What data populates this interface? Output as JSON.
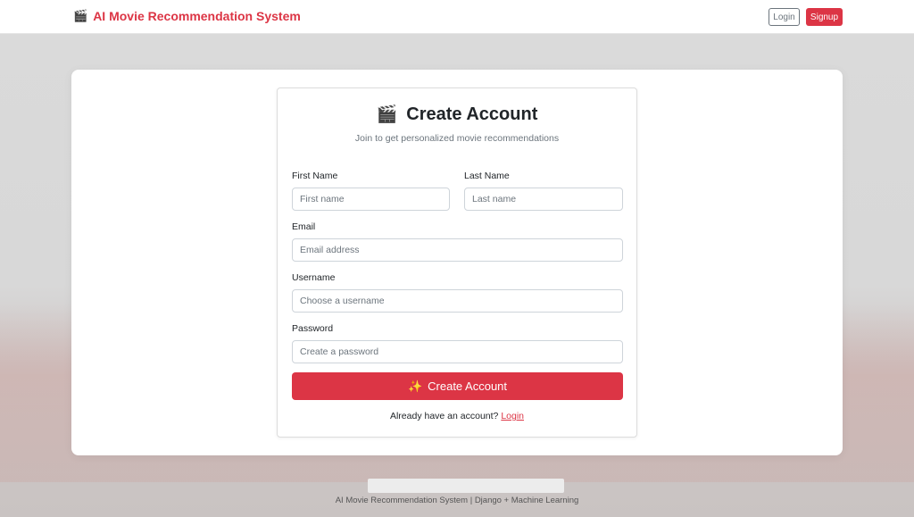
{
  "navbar": {
    "brand_icon": "clapper-board-icon",
    "brand_text": "AI Movie Recommendation System",
    "login_label": "Login",
    "signup_label": "Signup"
  },
  "form": {
    "title_icon": "clapper-board-icon",
    "title": "Create Account",
    "subtitle": "Join to get personalized movie recommendations",
    "first_name": {
      "label": "First Name",
      "placeholder": "First name"
    },
    "last_name": {
      "label": "Last Name",
      "placeholder": "Last name"
    },
    "email": {
      "label": "Email",
      "placeholder": "Email address"
    },
    "username": {
      "label": "Username",
      "placeholder": "Choose a username"
    },
    "password": {
      "label": "Password",
      "placeholder": "Create a password"
    },
    "submit_icon": "sparkles-icon",
    "submit_label": "Create Account",
    "login_prompt": "Already have an account?",
    "login_link": "Login"
  },
  "footer": {
    "text": "AI Movie Recommendation System | Django + Machine Learning"
  },
  "colors": {
    "accent": "#dc3545",
    "background": "#d9d9d9"
  }
}
